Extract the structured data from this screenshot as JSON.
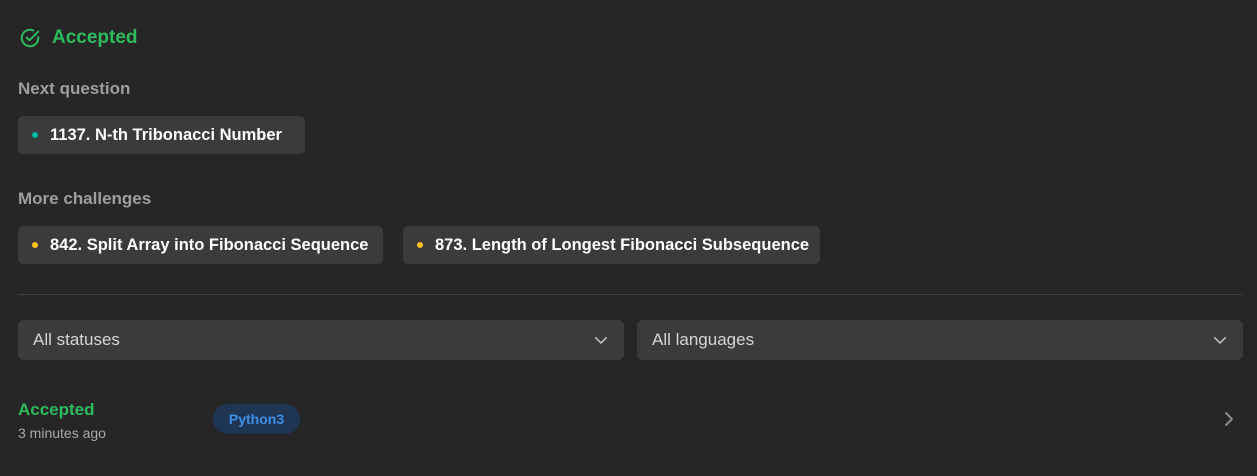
{
  "result": {
    "status": "Accepted",
    "icon": "check-circle-icon",
    "color": "#2cbb5d"
  },
  "next_question": {
    "label": "Next question",
    "items": [
      {
        "title": "1137. N-th Tribonacci Number",
        "difficulty_color": "#00b8a3"
      }
    ]
  },
  "more_challenges": {
    "label": "More challenges",
    "items": [
      {
        "title": "842. Split Array into Fibonacci Sequence",
        "difficulty_color": "#ffc01e"
      },
      {
        "title": "873. Length of Longest Fibonacci Subsequence",
        "difficulty_color": "#ffc01e"
      }
    ]
  },
  "filters": {
    "status": {
      "selected": "All statuses",
      "icon": "chevron-down-icon"
    },
    "language": {
      "selected": "All languages",
      "icon": "chevron-down-icon"
    }
  },
  "submissions": [
    {
      "status": "Accepted",
      "time": "3 minutes ago",
      "language": "Python3",
      "icon": "chevron-right-icon"
    }
  ]
}
